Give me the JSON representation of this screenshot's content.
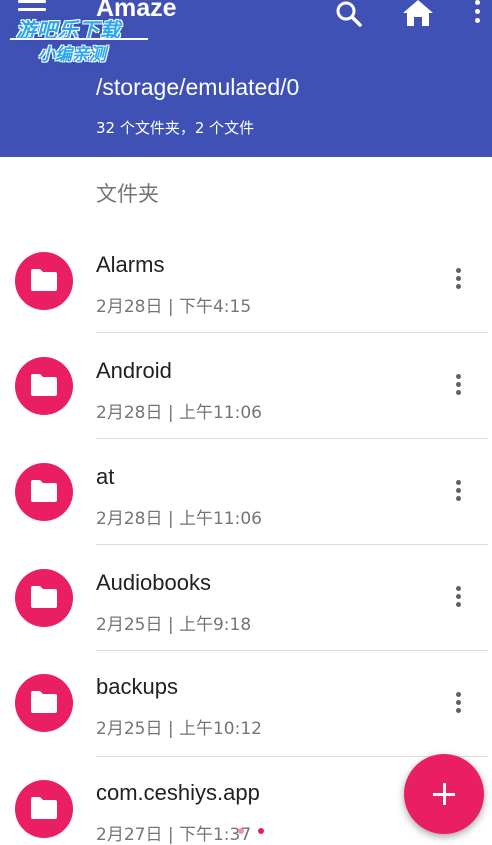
{
  "app": {
    "title": "Amaze",
    "path": "/storage/emulated/0",
    "summary": "32 个文件夹，2 个文件"
  },
  "watermark": {
    "line1": "游吧乐下载",
    "line2": "小编亲测"
  },
  "toolbar": {
    "icons": [
      "menu-icon",
      "search-icon",
      "home-icon",
      "more-vert-icon"
    ]
  },
  "section": {
    "folders_label": "文件夹"
  },
  "items": [
    {
      "name": "Alarms",
      "date": "2月28日 | 下午4:15"
    },
    {
      "name": "Android",
      "date": "2月28日 | 上午11:06"
    },
    {
      "name": "at",
      "date": "2月28日 | 上午11:06"
    },
    {
      "name": "Audiobooks",
      "date": "2月25日 | 上午9:18"
    },
    {
      "name": "backups",
      "date": "2月25日 | 上午10:12"
    },
    {
      "name": "com.ceshiys.app",
      "date": "2月27日 | 下午1:37"
    }
  ],
  "fab": {
    "icon": "plus-icon"
  },
  "colors": {
    "primary": "#3f51b5",
    "accent": "#e91e63"
  }
}
